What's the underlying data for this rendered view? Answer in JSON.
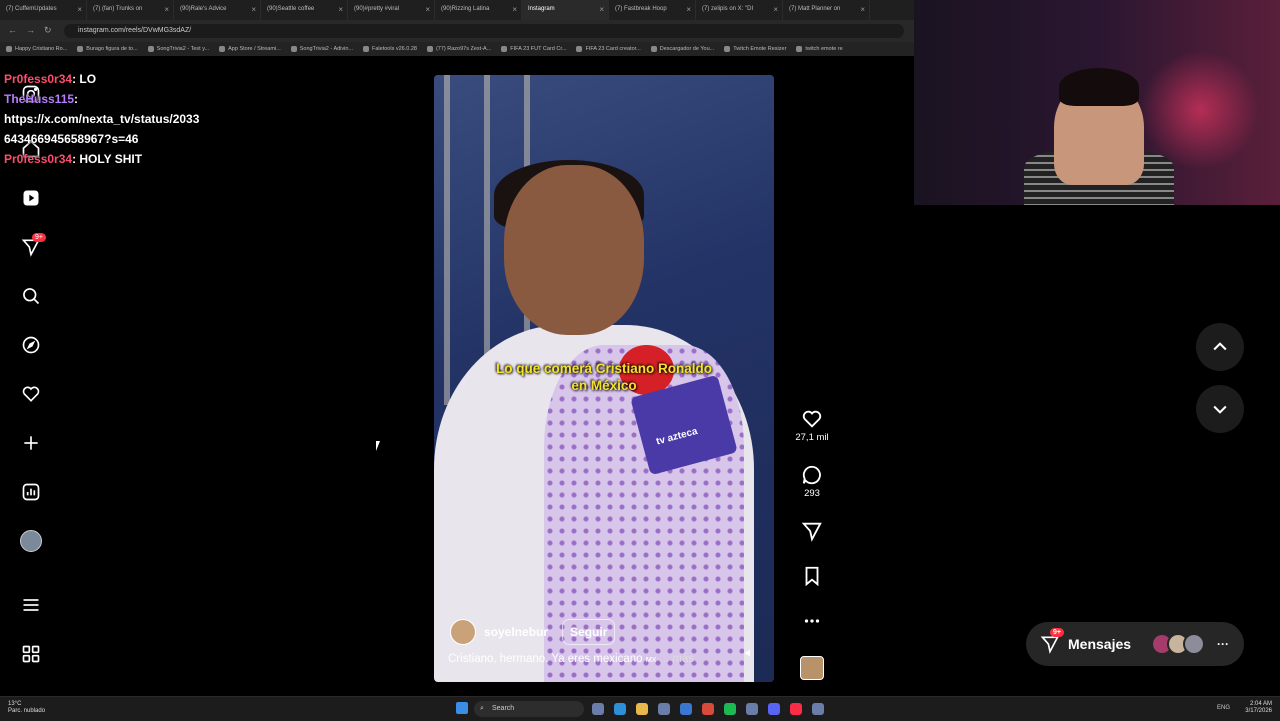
{
  "browser": {
    "tabs": [
      {
        "label": "(7) CuffemUpdates"
      },
      {
        "label": "(7) (fan) Trunks on"
      },
      {
        "label": "(90)Rale's Advice"
      },
      {
        "label": "(90)Seattle coffee"
      },
      {
        "label": "(90)#pretty #viral"
      },
      {
        "label": "(90)Rizzing Latina"
      },
      {
        "label": "Instagram"
      },
      {
        "label": "(7) Fastbreak Hoop"
      },
      {
        "label": "(7) zelipis on X: \"DI"
      },
      {
        "label": "(7) Matt Planner on"
      }
    ],
    "url": "instagram.com/reels/DVwMG3sdAZ/",
    "bookmarks": [
      "Happy Cristiano Ro...",
      "Burago figura de to...",
      "SongTrivia2 - Test y...",
      "App Store / Streami...",
      "SongTrivia2 - Adivin...",
      "Faletools v26.0.28",
      "(77) Razo97s Zest-A...",
      "FIFA 23 FUT Card Cr...",
      "FIFA 23 Card creator...",
      "Descargador de You...",
      "Twitch Emote Resizer",
      "twitch emote re"
    ]
  },
  "chat": {
    "messages": [
      {
        "user": "Pr0fess0r34",
        "text": ": LO"
      },
      {
        "user": "TheHuss115",
        "text": ":"
      },
      {
        "user": "",
        "text": "https://x.com/nexta_tv/status/2033"
      },
      {
        "user": "",
        "text": "643466945658967?s=46"
      },
      {
        "user": "Pr0fess0r34",
        "text": ": HOLY SHIT"
      }
    ]
  },
  "sidebar": {
    "notifications_badge": "9+"
  },
  "reel": {
    "caption_line1": "Lo que comerá Cristiano Ronaldo",
    "caption_line2": "en México",
    "mic_brand": "tv azteca",
    "author": "soyelnebur",
    "follow_label": "Seguir",
    "description": "Cristiano, hermano. Ya eres mexicano ",
    "description_more": "... más",
    "likes": "27,1 mil",
    "comments": "293"
  },
  "messages": {
    "label": "Mensajes",
    "badge": "9+"
  },
  "taskbar": {
    "weather_temp": "13°C",
    "weather_desc": "Parc. nublado",
    "search_placeholder": "Search",
    "lang": "ENG",
    "time": "2:04 AM",
    "date": "3/17/2026"
  },
  "colors": {
    "badge": "#ff3040",
    "caption": "#f6e22a"
  }
}
